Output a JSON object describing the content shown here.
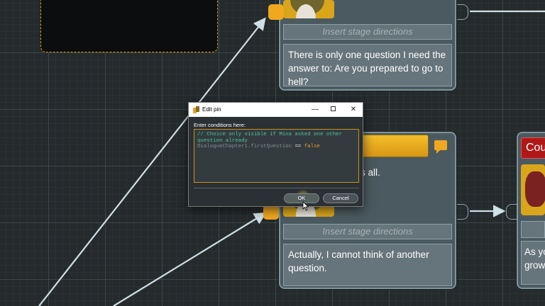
{
  "top_node": {
    "stage_directions_placeholder": "Insert stage directions",
    "text": "There is only one question I need the answer to: Are you prepared to go to hell?"
  },
  "middle_node": {
    "partial_text": "s all.",
    "stage_directions_placeholder": "Insert stage directions",
    "text": "Actually, I cannot think of another question."
  },
  "right_node": {
    "title_partial": "Cou",
    "text_partial_line1": "As yo",
    "text_partial_line2": "grow"
  },
  "dialog": {
    "title": "Edit pin",
    "prompt": "Enter conditions here:",
    "code": {
      "comment_line1": "// Choice only visible if Mina asked one other",
      "comment_line2": "question already",
      "identifier": "DialogueChapter1.firstQuestion",
      "operator": " == ",
      "keyword": "false"
    },
    "ok_label": "OK",
    "cancel_label": "Cancel",
    "minimize_glyph": "—",
    "close_glyph": "✕"
  },
  "colors": {
    "accent_orange": "#f0a81e",
    "node_background": "#4b5a60",
    "canvas_background": "#252a2c",
    "speaker_red": "#b01818"
  }
}
